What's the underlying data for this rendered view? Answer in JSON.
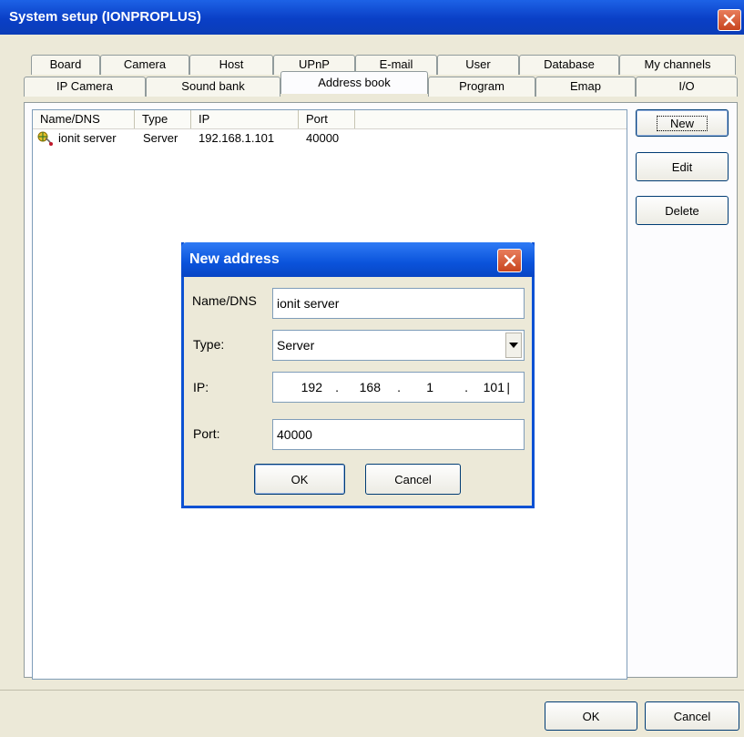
{
  "window": {
    "title": "System setup (IONPROPLUS)"
  },
  "tabs_row1": [
    "Board",
    "Camera",
    "Host",
    "UPnP",
    "E-mail",
    "User",
    "Database",
    "My channels"
  ],
  "tabs_row2": [
    "IP Camera",
    "Sound bank",
    "Address book",
    "Program",
    "Emap",
    "I/O"
  ],
  "active_tab": "Address book",
  "list": {
    "columns": [
      "Name/DNS",
      "Type",
      "IP",
      "Port"
    ],
    "rows": [
      {
        "name": "ionit server",
        "type": "Server",
        "ip": "192.168.1.101",
        "port": "40000",
        "icon": "server-icon"
      }
    ]
  },
  "side_buttons": {
    "new": "New",
    "edit": "Edit",
    "delete": "Delete"
  },
  "footer": {
    "ok": "OK",
    "cancel": "Cancel"
  },
  "dialog": {
    "title": "New address",
    "name_label": "Name/DNS",
    "name_value": "ionit server",
    "type_label": "Type:",
    "type_value": "Server",
    "ip_label": "IP:",
    "ip_octets": [
      "192",
      "168",
      "1",
      "101"
    ],
    "port_label": "Port:",
    "port_value": "40000",
    "ok": "OK",
    "cancel": "Cancel"
  },
  "colors": {
    "titlebar": "#0a3fc6",
    "close": "#c8451f",
    "face": "#ece9d8"
  }
}
